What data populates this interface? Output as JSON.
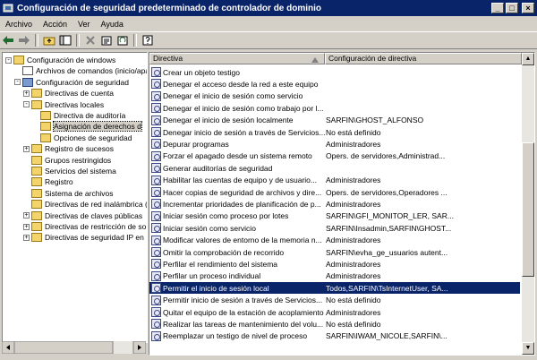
{
  "window": {
    "title": "Configuración de seguridad predeterminado de controlador de dominio",
    "minimize": "_",
    "maximize": "□",
    "close": "×"
  },
  "menu": [
    "Archivo",
    "Acción",
    "Ver",
    "Ayuda"
  ],
  "tree": [
    {
      "label": "Configuración de windows",
      "indent": 0,
      "expander": "-",
      "icon": "folder"
    },
    {
      "label": "Archivos de comandos (inicio/apa",
      "indent": 1,
      "expander": "",
      "icon": "doc"
    },
    {
      "label": "Configuración de seguridad",
      "indent": 1,
      "expander": "-",
      "icon": "shield"
    },
    {
      "label": "Directivas de cuenta",
      "indent": 2,
      "expander": "+",
      "icon": "folder"
    },
    {
      "label": "Directivas locales",
      "indent": 2,
      "expander": "-",
      "icon": "folder"
    },
    {
      "label": "Directiva de auditoría",
      "indent": 3,
      "expander": "",
      "icon": "folder"
    },
    {
      "label": "Asignación de derechos d",
      "indent": 3,
      "expander": "",
      "icon": "folder",
      "selected": true
    },
    {
      "label": "Opciones de seguridad",
      "indent": 3,
      "expander": "",
      "icon": "folder"
    },
    {
      "label": "Registro de sucesos",
      "indent": 2,
      "expander": "+",
      "icon": "folder"
    },
    {
      "label": "Grupos restringidos",
      "indent": 2,
      "expander": "",
      "icon": "folder"
    },
    {
      "label": "Servicios del sistema",
      "indent": 2,
      "expander": "",
      "icon": "folder"
    },
    {
      "label": "Registro",
      "indent": 2,
      "expander": "",
      "icon": "folder"
    },
    {
      "label": "Sistema de archivos",
      "indent": 2,
      "expander": "",
      "icon": "folder"
    },
    {
      "label": "Directivas de red inalámbrica (I",
      "indent": 2,
      "expander": "",
      "icon": "folder"
    },
    {
      "label": "Directivas de claves públicas",
      "indent": 2,
      "expander": "+",
      "icon": "folder"
    },
    {
      "label": "Directivas de restricción de so",
      "indent": 2,
      "expander": "+",
      "icon": "folder"
    },
    {
      "label": "Directivas de seguridad IP en",
      "indent": 2,
      "expander": "+",
      "icon": "folder"
    }
  ],
  "columns": {
    "policy": "Directiva",
    "setting": "Configuración de directiva"
  },
  "rows": [
    {
      "policy": "Crear un objeto testigo",
      "setting": ""
    },
    {
      "policy": "Denegar el acceso desde la red a este equipo",
      "setting": ""
    },
    {
      "policy": "Denegar el inicio de sesión como servicio",
      "setting": ""
    },
    {
      "policy": "Denegar el inicio de sesión como trabajo por l...",
      "setting": ""
    },
    {
      "policy": "Denegar el inicio de sesión localmente",
      "setting": "SARFIN\\GHOST_ALFONSO"
    },
    {
      "policy": "Denegar inicio de sesión a través de Servicios...",
      "setting": "No está definido"
    },
    {
      "policy": "Depurar programas",
      "setting": "Administradores"
    },
    {
      "policy": "Forzar el apagado desde un sistema remoto",
      "setting": "Opers. de servidores,Administrad..."
    },
    {
      "policy": "Generar auditorías de seguridad",
      "setting": ""
    },
    {
      "policy": "Habilitar las cuentas de equipo y de usuario...",
      "setting": "Administradores"
    },
    {
      "policy": "Hacer copias de seguridad de archivos y dire...",
      "setting": "Opers. de servidores,Operadores ..."
    },
    {
      "policy": "Incrementar prioridades de planificación de p...",
      "setting": "Administradores"
    },
    {
      "policy": "Iniciar sesión como proceso por lotes",
      "setting": "SARFIN\\GFI_MONITOR_LER, SAR..."
    },
    {
      "policy": "Iniciar sesión como servicio",
      "setting": "SARFIN\\Insadmin,SARFIN\\GHOST..."
    },
    {
      "policy": "Modificar valores de entorno de la memoria n...",
      "setting": "Administradores"
    },
    {
      "policy": "Omitir la comprobación de recorrido",
      "setting": "SARFIN\\evha_ge_usuarios autent..."
    },
    {
      "policy": "Perfilar el rendimiento del sistema",
      "setting": "Administradores"
    },
    {
      "policy": "Perfilar un proceso individual",
      "setting": "Administradores"
    },
    {
      "policy": "Permitir el inicio de sesión local",
      "setting": "Todos,SARFIN\\TsInternetUser, SA...",
      "selected": true
    },
    {
      "policy": "Permitir inicio de sesión a través de Servicios...",
      "setting": "No está definido"
    },
    {
      "policy": "Quitar el equipo de la estación de acoplamiento",
      "setting": "Administradores"
    },
    {
      "policy": "Realizar las tareas de mantenimiento del volu...",
      "setting": "No está definido"
    },
    {
      "policy": "Reemplazar un testigo de nivel de proceso",
      "setting": "SARFIN\\IWAM_NICOLE,SARFIN\\..."
    }
  ]
}
